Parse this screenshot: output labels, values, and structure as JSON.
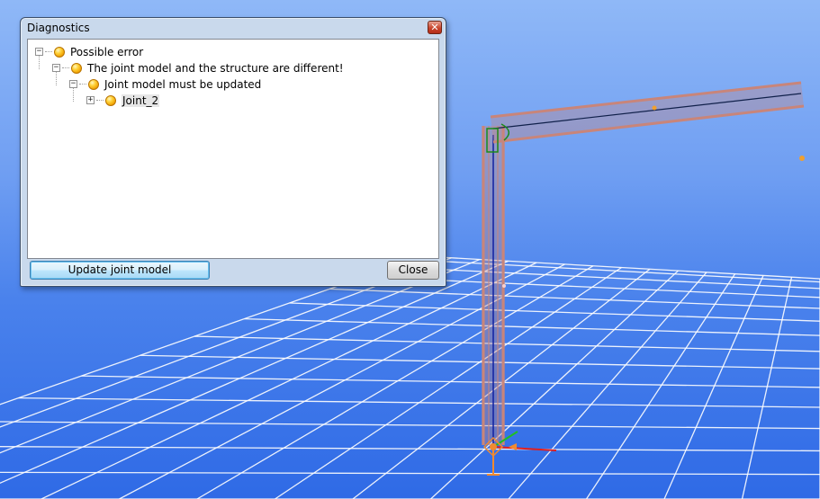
{
  "dialog": {
    "title": "Diagnostics",
    "close_glyph": "✕",
    "tree": [
      {
        "label": "Possible error",
        "level": 0,
        "expander": "−",
        "icon": "warning-bulb-icon"
      },
      {
        "label": "The joint model and the structure are different!",
        "level": 1,
        "expander": "−",
        "icon": "warning-bulb-icon"
      },
      {
        "label": "Joint model must be updated",
        "level": 2,
        "expander": "−",
        "icon": "warning-bulb-icon"
      },
      {
        "label": "Joint_2",
        "level": 3,
        "expander": "+",
        "icon": "warning-bulb-icon",
        "selected": true
      }
    ],
    "buttons": {
      "update": "Update joint model",
      "close": "Close"
    }
  },
  "viewport": {
    "background_top": "#8fb8f7",
    "background_bottom": "#2f6ae6",
    "grid_color": "#ffffff",
    "member_color": "#c8857a",
    "axis_x_color": "#e02020",
    "axis_y_color": "#20c020",
    "axis_z_color": "#1020a0"
  }
}
